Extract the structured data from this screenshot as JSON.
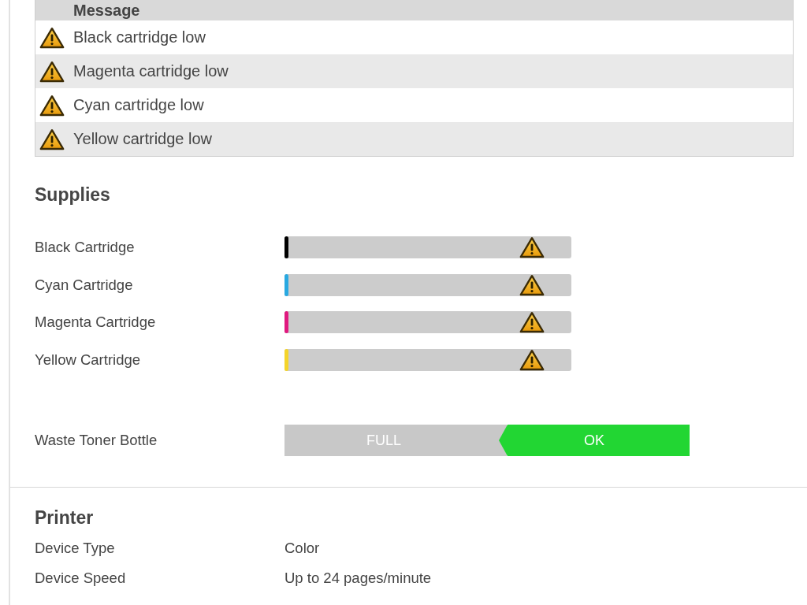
{
  "alerts_table": {
    "columns": [
      {
        "label": "Message"
      }
    ],
    "rows": [
      {
        "warning": true,
        "message": "Black cartridge low"
      },
      {
        "warning": true,
        "message": "Magenta cartridge low"
      },
      {
        "warning": true,
        "message": "Cyan cartridge low"
      },
      {
        "warning": true,
        "message": "Yellow cartridge low"
      }
    ]
  },
  "supplies": {
    "title": "Supplies",
    "cartridges": [
      {
        "name": "Black Cartridge",
        "color": "#000000",
        "level": 0.015,
        "warning": true
      },
      {
        "name": "Cyan Cartridge",
        "color": "#29a9e1",
        "level": 0.015,
        "warning": true
      },
      {
        "name": "Magenta Cartridge",
        "color": "#e0197f",
        "level": 0.015,
        "warning": true
      },
      {
        "name": "Yellow Cartridge",
        "color": "#f4d42a",
        "level": 0.015,
        "warning": true
      }
    ],
    "waste_toner": {
      "label": "Waste Toner Bottle",
      "segments": [
        {
          "label": "FULL",
          "selected": false
        },
        {
          "label": "OK",
          "selected": true
        }
      ]
    }
  },
  "printer": {
    "title": "Printer",
    "rows": [
      {
        "label": "Device Type",
        "value": "Color"
      },
      {
        "label": "Device Speed",
        "value": "Up to 24 pages/minute"
      }
    ]
  }
}
